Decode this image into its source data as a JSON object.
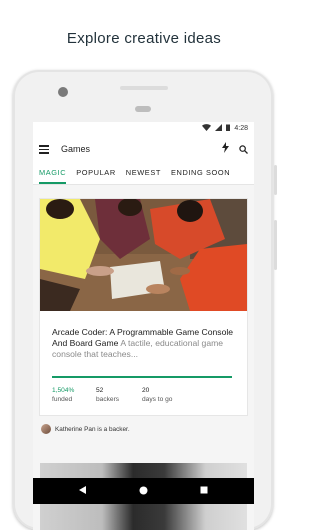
{
  "headline": "Explore creative ideas",
  "status_bar": {
    "time": "4:28"
  },
  "app_bar": {
    "title": "Games"
  },
  "tabs": [
    {
      "label": "MAGIC",
      "active": true
    },
    {
      "label": "POPULAR",
      "active": false
    },
    {
      "label": "NEWEST",
      "active": false
    },
    {
      "label": "ENDING SOON",
      "active": false
    }
  ],
  "card": {
    "title": "Arcade Coder: A Programmable Game Console And Board Game",
    "blurb": "A tactile, educational game console that teaches...",
    "funded_value": "1,504%",
    "funded_label": "funded",
    "backers_value": "52",
    "backers_label": "backers",
    "days_value": "20",
    "days_label": "days to go"
  },
  "backer_note": "Katherine Pan is a backer.",
  "colors": {
    "accent": "#159a66"
  },
  "icons": {
    "menu": "menu-icon",
    "bolt": "lightning-bolt-icon",
    "search": "search-icon",
    "nav": [
      "back-icon",
      "home-icon",
      "recents-icon"
    ]
  }
}
